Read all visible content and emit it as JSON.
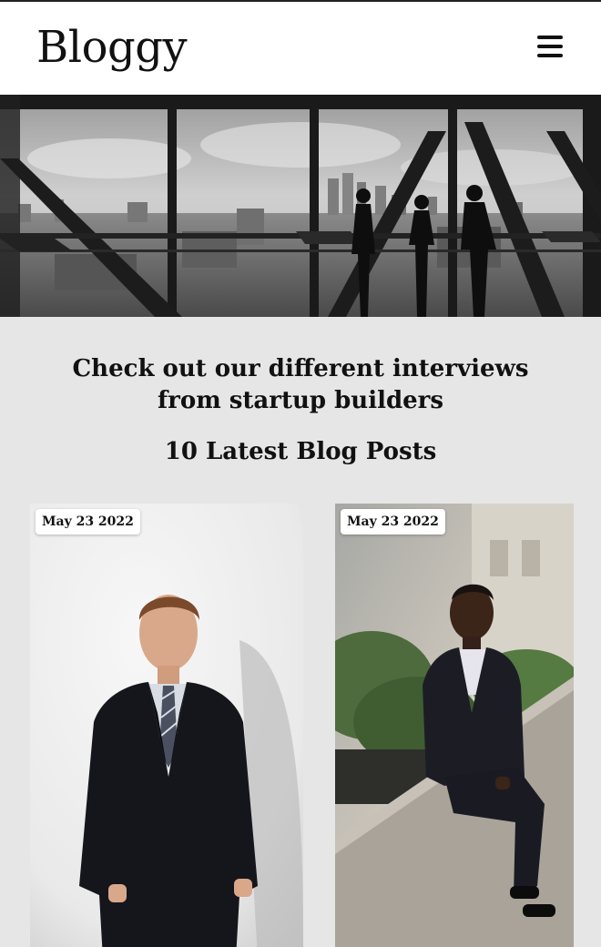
{
  "header": {
    "logo": "Bloggy",
    "menu_icon": "hamburger-menu-icon"
  },
  "hero": {
    "image": "office-skyline-silhouettes-photo"
  },
  "intro": {
    "headline": "Check out our different interviews from startup builders",
    "subhead": "10 Latest Blog Posts"
  },
  "posts": [
    {
      "date": "May 23 2022",
      "image": "businessman-in-suit-portrait"
    },
    {
      "date": "May 23 2022",
      "image": "smiling-man-sitting-on-wall-portrait"
    }
  ],
  "colors": {
    "page_background": "#e6e6e6",
    "header_background": "#ffffff",
    "text": "#111111"
  }
}
